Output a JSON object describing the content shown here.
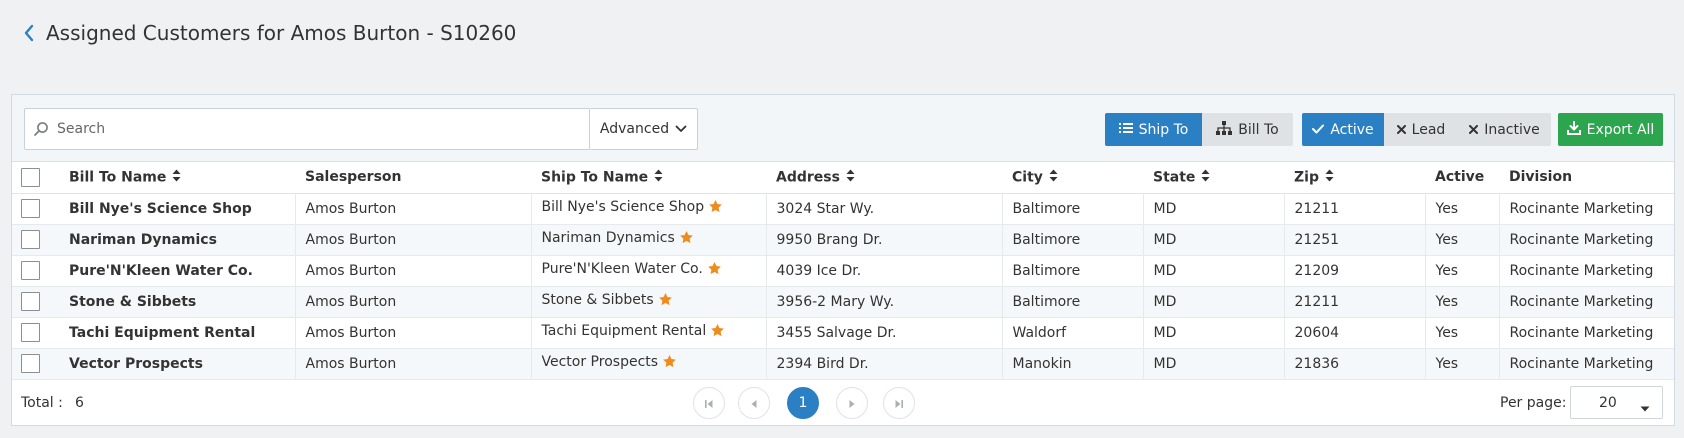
{
  "header": {
    "title": "Assigned Customers for Amos Burton - S10260"
  },
  "toolbar": {
    "search_placeholder": "Search",
    "advanced_label": "Advanced",
    "ship_to_label": "Ship To",
    "bill_to_label": "Bill To",
    "active_label": "Active",
    "lead_label": "Lead",
    "inactive_label": "Inactive",
    "export_label": "Export All"
  },
  "table": {
    "columns": [
      "Bill To Name",
      "Salesperson",
      "Ship To Name",
      "Address",
      "City",
      "State",
      "Zip",
      "Active",
      "Division"
    ],
    "rows": [
      {
        "bill_to": "Bill Nye's Science Shop",
        "salesperson": "Amos Burton",
        "ship_to": "Bill Nye's Science Shop",
        "address": "3024 Star Wy.",
        "city": "Baltimore",
        "state": "MD",
        "zip": "21211",
        "active": "Yes",
        "division": "Rocinante Marketing"
      },
      {
        "bill_to": "Nariman Dynamics",
        "salesperson": "Amos Burton",
        "ship_to": "Nariman Dynamics",
        "address": "9950 Brang Dr.",
        "city": "Baltimore",
        "state": "MD",
        "zip": "21251",
        "active": "Yes",
        "division": "Rocinante Marketing"
      },
      {
        "bill_to": "Pure'N'Kleen Water Co.",
        "salesperson": "Amos Burton",
        "ship_to": "Pure'N'Kleen Water Co.",
        "address": "4039 Ice Dr.",
        "city": "Baltimore",
        "state": "MD",
        "zip": "21209",
        "active": "Yes",
        "division": "Rocinante Marketing"
      },
      {
        "bill_to": "Stone & Sibbets",
        "salesperson": "Amos Burton",
        "ship_to": "Stone & Sibbets",
        "address": "3956-2 Mary Wy.",
        "city": "Baltimore",
        "state": "MD",
        "zip": "21211",
        "active": "Yes",
        "division": "Rocinante Marketing"
      },
      {
        "bill_to": "Tachi Equipment Rental",
        "salesperson": "Amos Burton",
        "ship_to": "Tachi Equipment Rental",
        "address": "3455 Salvage Dr.",
        "city": "Waldorf",
        "state": "MD",
        "zip": "20604",
        "active": "Yes",
        "division": "Rocinante Marketing"
      },
      {
        "bill_to": "Vector Prospects",
        "salesperson": "Amos Burton",
        "ship_to": "Vector Prospects",
        "address": "2394 Bird Dr.",
        "city": "Manokin",
        "state": "MD",
        "zip": "21836",
        "active": "Yes",
        "division": "Rocinante Marketing"
      }
    ]
  },
  "footer": {
    "total_label": "Total :",
    "total_value": "6",
    "current_page": "1",
    "per_page_label": "Per page:",
    "per_page_value": "20"
  },
  "colors": {
    "primary": "#2b7fc3",
    "export": "#2da44e",
    "star": "#f08c1e"
  }
}
